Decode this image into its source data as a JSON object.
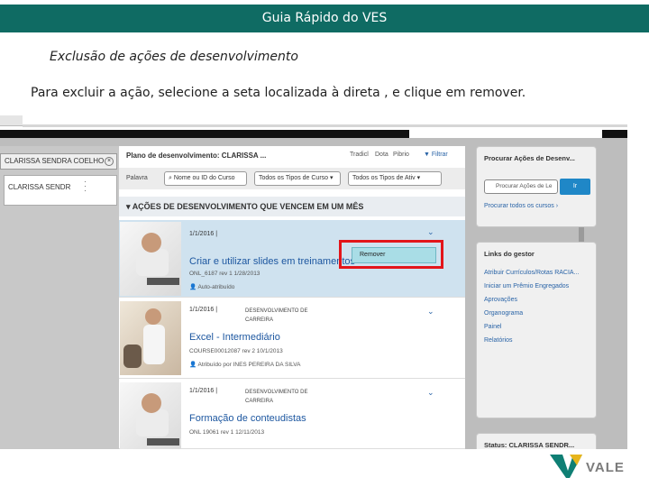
{
  "header": {
    "title": "Guia Rápido do VES"
  },
  "subtitle": "Exclusão de ações de desenvolvimento",
  "instruction": "Para excluir a ação, selecione a seta localizada à direta , e clique em remover.",
  "left_panel": {
    "user_name": "CLARISSA SENDRA COELHO",
    "search_value": "CLARISSA SENDR"
  },
  "center": {
    "plan_title": "Plano de desenvolvimento: CLARISSA ...",
    "toolbar": {
      "icon1": "Tradicl",
      "icon2": "Dota",
      "icon3": "Pibrio",
      "filter": "Filtrar"
    },
    "toolbar2": {
      "label": "Palavra",
      "search_placeholder": "Nome ou ID do Curso",
      "type_filter": "Todos os Tipos de Curso",
      "activity_filter": "Todos os Tipos de Ativ"
    },
    "section_title": "AÇÕES DE DESENVOLVIMENTO QUE VENCEM EM UM MÊS",
    "items": [
      {
        "date": "1/1/2016 |",
        "category": "",
        "title": "Criar e utilizar slides em treinamentos",
        "meta1": "ONL_6187 rev 1 1/28/2013",
        "meta2": "Auto-atribuído"
      },
      {
        "date": "1/1/2016 |",
        "category": "DESENVOLVIMENTO DE CARREIRA",
        "title": "Excel - Intermediário",
        "meta1": "COURSE00012087 rev 2 10/1/2013",
        "meta2": "Atribuído por INES PEREIRA DA SILVA"
      },
      {
        "date": "1/1/2016 |",
        "category": "DESENVOLVIMENTO DE CARREIRA",
        "title": "Formação de conteudistas",
        "meta1": "ONL 19061 rev 1 12/11/2013",
        "meta2": ""
      }
    ],
    "remove_label": "Remover"
  },
  "right": {
    "search_panel_title": "Procurar Ações de Desenv...",
    "search_placeholder": "Procurar Ações de Le",
    "go_label": "Ir",
    "browse_link": "Procurar todos os cursos",
    "links_title": "Links do gestor",
    "links": [
      "Atribuir Currículos/Rotas RACIA...",
      "Iniciar um Prêmio Engregados",
      "Aprovações",
      "Organograma",
      "Painel",
      "Relatórios"
    ],
    "status_title": "Status: CLARISSA SENDR..."
  },
  "logo": {
    "text": "VALE"
  },
  "colors": {
    "header_bg": "#0f6b63",
    "link": "#2a64a7",
    "highlight": "#e3151a",
    "selected_row": "#cfe2ef"
  }
}
